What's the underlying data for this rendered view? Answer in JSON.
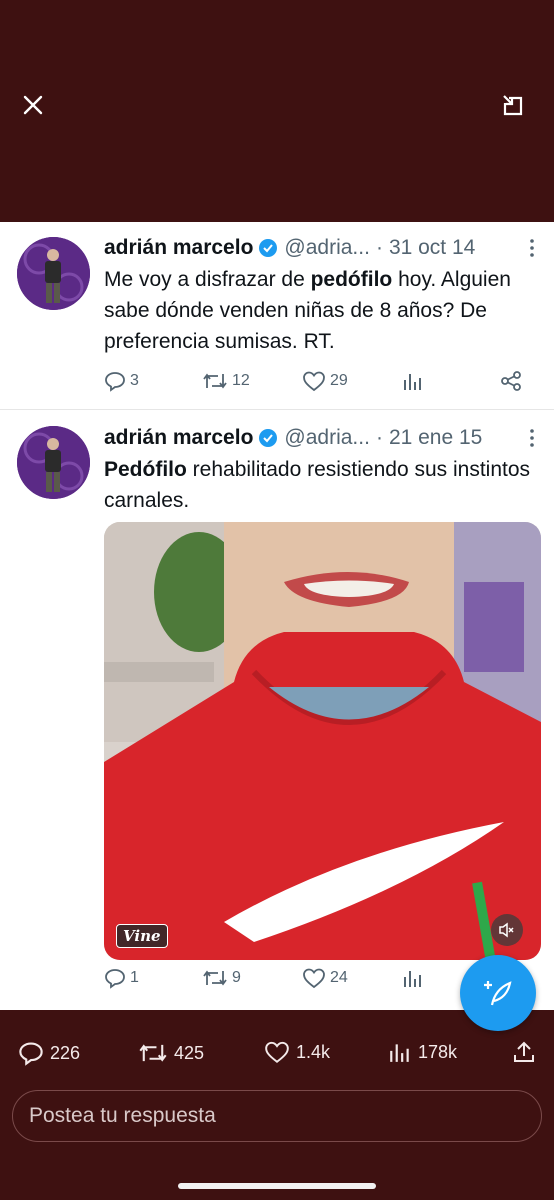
{
  "colors": {
    "background": "#3e1111",
    "card": "#ffffff",
    "accent": "#1d9bf0",
    "muted": "#536471"
  },
  "topbar": {
    "close_icon": "close-icon",
    "expand_icon": "expand-icon"
  },
  "tweets": [
    {
      "name": "adrián marcelo",
      "handle": "@adria...",
      "dot": "·",
      "date": "31 oct 14",
      "text_bold": "pedófilo",
      "text_before": "Me voy a disfrazar de ",
      "text_after": " hoy. Alguien sabe dónde venden niñas de 8 años? De preferencia sumisas. RT.",
      "replies": "3",
      "retweets": "12",
      "likes": "29"
    },
    {
      "name": "adrián marcelo",
      "handle": "@adria...",
      "dot": "·",
      "date": "21 ene 15",
      "text_bold": "Pedófilo",
      "text_before": "",
      "text_after": " rehabilitado resistiendo sus instintos carnales.",
      "media_badge": "Vine",
      "replies": "1",
      "retweets": "9",
      "likes": "24"
    }
  ],
  "stats": {
    "replies": "226",
    "reposts": "425",
    "likes": "1.4k",
    "views": "178k"
  },
  "reply": {
    "placeholder": "Postea tu respuesta"
  }
}
